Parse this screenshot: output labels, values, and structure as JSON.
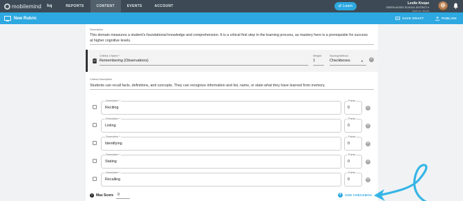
{
  "topnav": {
    "logo_text": "mobilemind",
    "hq": "hq",
    "items": [
      {
        "label": "REPORTS",
        "active": false
      },
      {
        "label": "CONTENT",
        "active": true
      },
      {
        "label": "EVENTS",
        "active": false
      },
      {
        "label": "ACCOUNT",
        "active": false
      }
    ],
    "learn_label": "Learn",
    "user": {
      "name": "Leslie Knope",
      "district": "GREEN ACRES SCHOOL DISTRICT",
      "role": "VIEW ALL ROLES"
    }
  },
  "subheader": {
    "title": "New Rubric",
    "save_draft": "SAVE DRAFT",
    "publish": "PUBLISH"
  },
  "rubric": {
    "description_label": "Description",
    "description": "This domain measures a student's foundational knowledge and comprehension. It is a critical first step in the learning process, as mastery here is a prerequisite for success at higher cognitive levels.",
    "criteria": {
      "name_label": "Criteria 1 Name *",
      "name": "Remembering (Observations)",
      "weight_label": "Weight",
      "weight": "1",
      "method_label": "Scoring Method",
      "method": "Checkboxes",
      "description_label": "Criteria Description",
      "description": "Students can recall facts, definitions, and concepts. They can recognize information and list, name, or state what they have learned from memory."
    },
    "checkboxes": [
      {
        "desc_label": "Description *",
        "desc": "Reciting",
        "points_label": "Points",
        "points": "0"
      },
      {
        "desc_label": "Description *",
        "desc": "Listing",
        "points_label": "Points",
        "points": "0"
      },
      {
        "desc_label": "Description *",
        "desc": "Identifying",
        "points_label": "Points",
        "points": "0"
      },
      {
        "desc_label": "Description *",
        "desc": "Stating",
        "points_label": "Points",
        "points": "0"
      },
      {
        "desc_label": "Description *",
        "desc": "Recalling",
        "points_label": "Points",
        "points": "0"
      }
    ],
    "max_score_label": "Max Score",
    "max_score": "0",
    "add_checkbox": "ADD CHECKBOX"
  },
  "colors": {
    "nav_bg": "#3d4a55",
    "accent": "#2ea8e0",
    "annotation": "#35b5e5"
  },
  "icons": [
    "logo-icon",
    "bell-icon",
    "rubric-icon",
    "save-icon",
    "publish-icon",
    "clipboard-icon",
    "remove-icon",
    "info-icon",
    "add-icon"
  ]
}
